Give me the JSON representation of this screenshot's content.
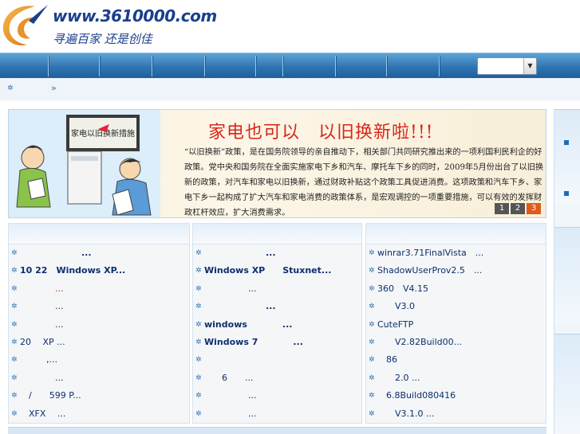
{
  "header": {
    "site_url": "www.3610000.com",
    "slogan": "寻遍百家 还是创佳"
  },
  "nav": {
    "select_value": ""
  },
  "breadcrumb": {
    "bullet": "✲",
    "separator": "»"
  },
  "banner": {
    "title": "家电也可以　以旧换新啦!!!",
    "body": "“以旧换新”政策，是在国务院领导的亲自推动下，相关部门共同研究推出来的一项利国利民利企的好政策。党中央和国务院在全面实施家电下乡和汽车、摩托车下乡的同时，2009年5月份出台了以旧换新的政策，对汽车和家电以旧换新，通过财政补贴这个政策工具促进消费。这项政策和汽车下乡、家电下乡一起构成了扩大汽车和家电消费的政策体系，是宏观调控的一项重要措施，可以有效的发挥财政杠杆效应，扩大消费需求。",
    "art_screen_text": "家电以旧换新措施",
    "pager": [
      "1",
      "2",
      "3"
    ],
    "active_page": "3"
  },
  "columns": [
    {
      "items": [
        {
          "text": "　　　　　　　...",
          "style": "bold"
        },
        {
          "text": "10  22　Windows XP...",
          "style": "bold"
        },
        {
          "text": "　　　　...",
          "style": "red"
        },
        {
          "text": "　　　　...",
          "style": ""
        },
        {
          "text": "　　　　...",
          "style": ""
        },
        {
          "text": "20　 XP  ...",
          "style": ""
        },
        {
          "text": "　　　,...",
          "style": ""
        },
        {
          "text": "　　　　...",
          "style": ""
        },
        {
          "text": "　/　　599 P...",
          "style": ""
        },
        {
          "text": "　XFX　 ...",
          "style": ""
        }
      ]
    },
    {
      "items": [
        {
          "text": "　　　　　　　...",
          "style": "bold"
        },
        {
          "text": "Windows XP　　Stuxnet...",
          "style": "bold"
        },
        {
          "text": "　　　　　...",
          "style": ""
        },
        {
          "text": "　　　　　　　...",
          "style": "bold"
        },
        {
          "text": "windows　　　　...",
          "style": "bold"
        },
        {
          "text": "Windows 7　　　　...",
          "style": "bold"
        },
        {
          "text": "",
          "style": ""
        },
        {
          "text": "　　6　　...",
          "style": ""
        },
        {
          "text": "　　　　　...",
          "style": ""
        },
        {
          "text": "　　　　　...",
          "style": ""
        }
      ]
    },
    {
      "items": [
        {
          "text": "winrar3.71FinalVista　...",
          "style": ""
        },
        {
          "text": "ShadowUserProv2.5　...",
          "style": ""
        },
        {
          "text": "360　V4.15",
          "style": ""
        },
        {
          "text": "　　V3.0",
          "style": ""
        },
        {
          "text": "CuteFTP",
          "style": ""
        },
        {
          "text": "　　V2.82Build00...",
          "style": ""
        },
        {
          "text": "　86",
          "style": ""
        },
        {
          "text": "　　2.0  ...",
          "style": ""
        },
        {
          "text": "　6.8Build080416",
          "style": ""
        },
        {
          "text": "　　V3.1.0  ...",
          "style": ""
        }
      ]
    }
  ]
}
